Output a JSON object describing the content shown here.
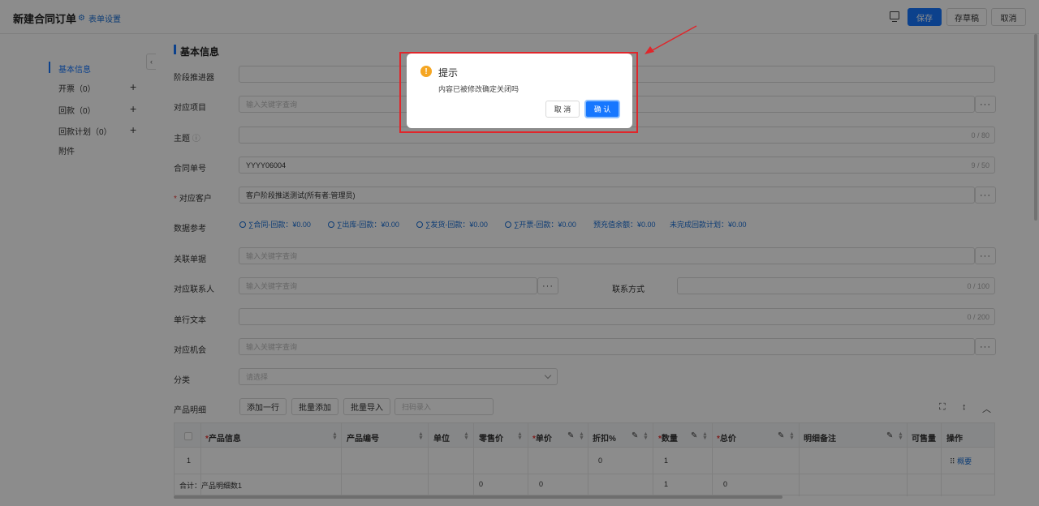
{
  "header": {
    "title": "新建合同订单",
    "form_settings": "表单设置",
    "save": "保存",
    "draft": "存草稿",
    "cancel": "取消"
  },
  "sidebar": {
    "items": [
      {
        "label": "基本信息",
        "active": true
      },
      {
        "label": "开票（0）"
      },
      {
        "label": "回款（0）"
      },
      {
        "label": "回款计划（0）"
      },
      {
        "label": "附件"
      }
    ]
  },
  "section": {
    "title": "基本信息"
  },
  "form": {
    "stage": {
      "label": "阶段推进器"
    },
    "project": {
      "label": "对应项目",
      "placeholder": "输入关键字查询"
    },
    "subject": {
      "label": "主题",
      "counter": "0 / 80"
    },
    "contract_no": {
      "label": "合同单号",
      "value": "YYYY06004",
      "counter": "9 / 50"
    },
    "customer": {
      "label": "对应客户",
      "value": "客户阶段推送测试(所有者:管理员)"
    },
    "reference": {
      "label": "数据参考",
      "items": [
        "∑合同-回款：¥0.00",
        "∑出库-回款：¥0.00",
        "∑发货-回款：¥0.00",
        "∑开票-回款：¥0.00",
        "预充值余额：¥0.00",
        "未完成回款计划：¥0.00"
      ]
    },
    "related_doc": {
      "label": "关联单据",
      "placeholder": "输入关键字查询"
    },
    "contact": {
      "label": "对应联系人",
      "placeholder": "输入关键字查询"
    },
    "contact_method": {
      "label": "联系方式",
      "counter": "0 / 100"
    },
    "single_text": {
      "label": "单行文本",
      "counter": "0 / 200"
    },
    "opportunity": {
      "label": "对应机会",
      "placeholder": "输入关键字查询"
    },
    "category": {
      "label": "分类",
      "placeholder": "请选择"
    },
    "products": {
      "label": "产品明细",
      "add_row": "添加一行",
      "batch_add": "批量添加",
      "batch_import": "批量导入",
      "scan_placeholder": "扫码录入"
    }
  },
  "table": {
    "columns": [
      "产品信息",
      "产品编号",
      "单位",
      "零售价",
      "单价",
      "折扣%",
      "数量",
      "总价",
      "明细备注",
      "可售量",
      "操作"
    ],
    "row": {
      "index": "1",
      "discount": "0",
      "qty": "1",
      "action": "概要"
    },
    "summary": {
      "label": "合计：产品明细数1",
      "retail": "0",
      "price": "0",
      "qty": "1",
      "total": "0"
    }
  },
  "dialog": {
    "title": "提示",
    "message": "内容已被修改确定关闭吗",
    "cancel": "取 消",
    "confirm": "确 认"
  },
  "colors": {
    "primary": "#1677ff",
    "warning": "#f5a623",
    "annotation": "#e0262b"
  }
}
